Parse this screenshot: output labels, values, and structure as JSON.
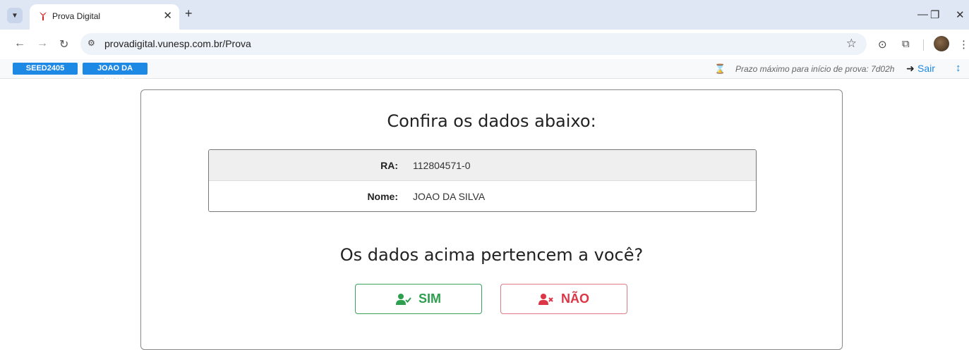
{
  "browser": {
    "tab_title": "Prova Digital",
    "tab_close": "✕",
    "new_tab": "+",
    "url": "provadigital.vunesp.com.br/Prova",
    "window_controls": {
      "minimize": "—",
      "restore": "❐",
      "close": "✕"
    },
    "nav": {
      "back": "←",
      "forward": "→",
      "reload": "↻"
    }
  },
  "app_bar": {
    "badges": [
      "SEED2405",
      "JOAO DA SILVA"
    ],
    "deadline_text": "Prazo máximo para início de prova: 7d02h",
    "logout_label": "Sair"
  },
  "main": {
    "title": "Confira os dados abaixo:",
    "rows": [
      {
        "label": "RA:",
        "value": "112804571-0"
      },
      {
        "label": "Nome:",
        "value": "JOAO DA SILVA"
      }
    ],
    "question": "Os dados acima pertencem a você?",
    "buttons": {
      "yes": "SIM",
      "no": "NÃO"
    }
  },
  "colors": {
    "accent": "#1e88e5",
    "yes": "#2e9e4f",
    "no": "#dc3545"
  }
}
